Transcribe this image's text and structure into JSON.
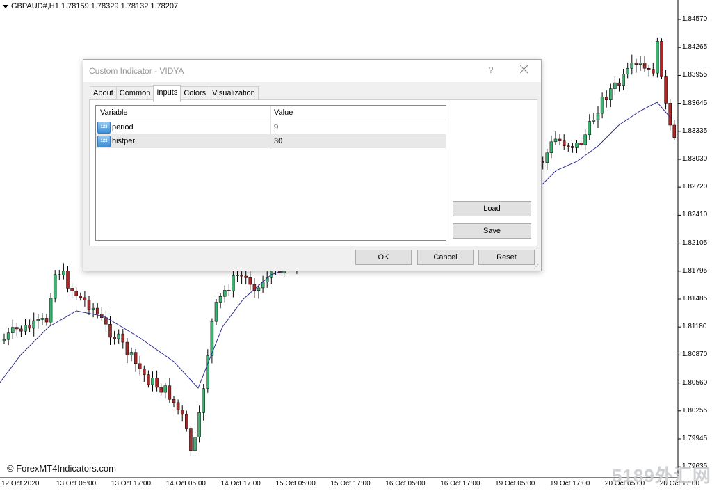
{
  "chart": {
    "symbol_line": "GBPAUD#,H1  1.78159 1.78329 1.78132 1.78207",
    "copyright": "© ForexMT4Indicators.com",
    "watermark": "5189外汇网",
    "price_labels": [
      "1.84570",
      "1.84265",
      "1.83955",
      "1.83645",
      "1.83335",
      "1.83030",
      "1.82720",
      "1.82410",
      "1.82105",
      "1.81795",
      "1.81485",
      "1.81180",
      "1.80870",
      "1.80560",
      "1.80255",
      "1.79945",
      "1.79635"
    ],
    "time_labels": [
      "12 Oct 2020",
      "13 Oct 05:00",
      "13 Oct 17:00",
      "14 Oct 05:00",
      "14 Oct 17:00",
      "15 Oct 05:00",
      "15 Oct 17:00",
      "16 Oct 05:00",
      "16 Oct 17:00",
      "19 Oct 05:00",
      "19 Oct 17:00",
      "20 Oct 05:00",
      "20 Oct 17:00"
    ],
    "colors": {
      "bull": "#3cb371",
      "bear": "#a52a2a",
      "vidya": "#2b2b8f"
    }
  },
  "dialog": {
    "title": "Custom Indicator - VIDYA",
    "help": "?",
    "tabs": [
      "About",
      "Common",
      "Inputs",
      "Colors",
      "Visualization"
    ],
    "active_tab": "Inputs",
    "grid": {
      "col_variable": "Variable",
      "col_value": "Value",
      "icon_text": "123",
      "rows": [
        {
          "name": "period",
          "value": "9"
        },
        {
          "name": "histper",
          "value": "30"
        }
      ]
    },
    "buttons": {
      "load": "Load",
      "save": "Save",
      "ok": "OK",
      "cancel": "Cancel",
      "reset": "Reset"
    }
  }
}
